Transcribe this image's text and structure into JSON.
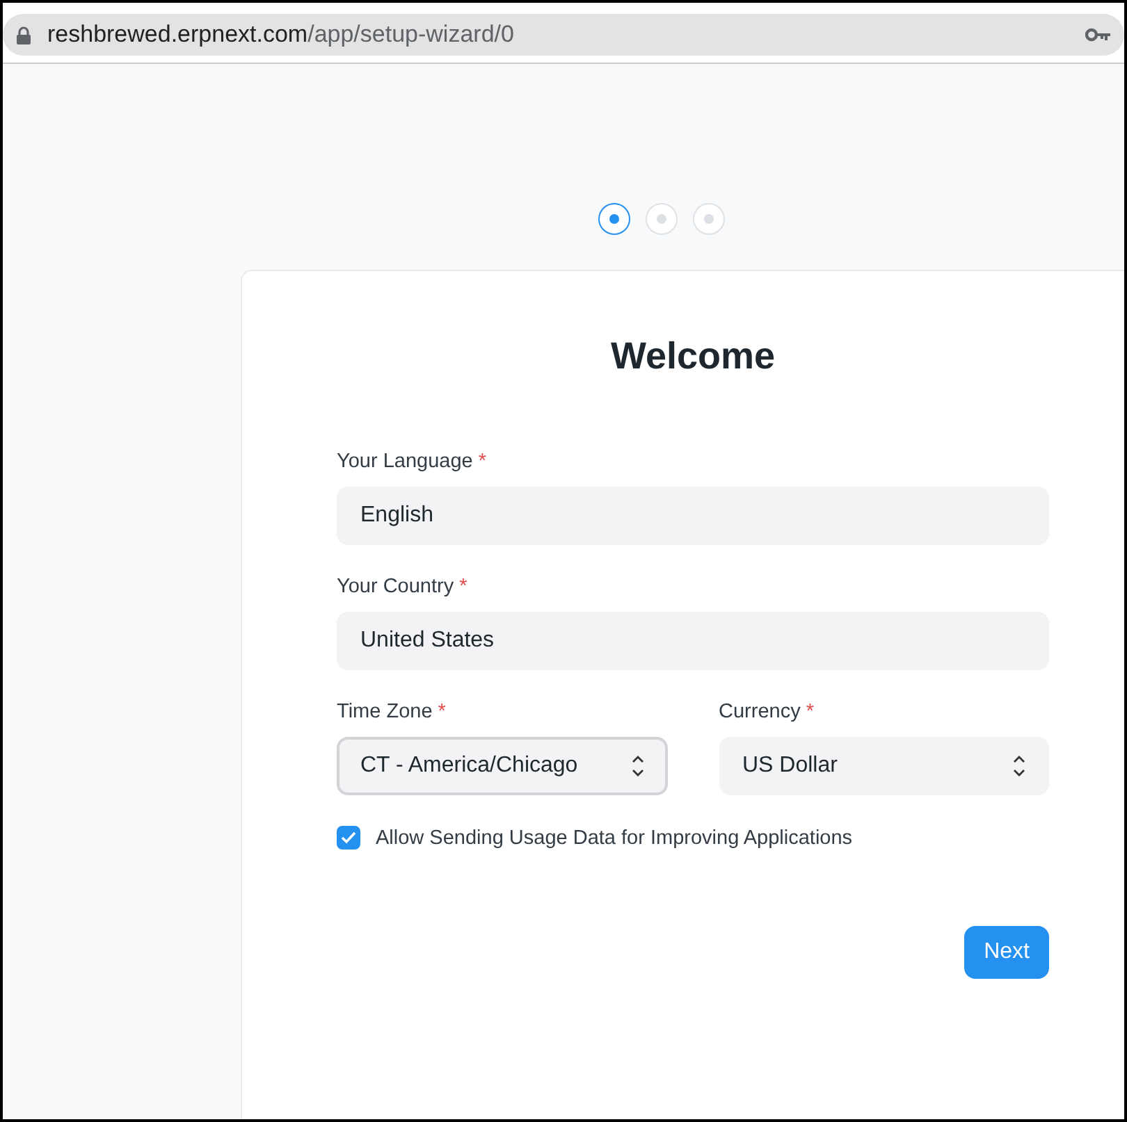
{
  "address_bar": {
    "host": "reshbrewed.erpnext.com",
    "path": "/app/setup-wizard/0"
  },
  "steps": [
    {
      "selected": true
    },
    {
      "selected": false
    },
    {
      "selected": false
    }
  ],
  "card": {
    "title": "Welcome",
    "fields": [
      {
        "kind": "text",
        "label": "Your Language",
        "required_mark": "*",
        "value": "English",
        "focused": false
      },
      {
        "kind": "text",
        "label": "Your Country",
        "required_mark": "*",
        "value": "United States",
        "focused": false
      },
      {
        "kind": "select",
        "label": "Time Zone",
        "required_mark": "*",
        "value": "CT - America/Chicago",
        "focused": true
      },
      {
        "kind": "select",
        "label": "Currency",
        "required_mark": "*",
        "value": "US Dollar",
        "focused": false
      }
    ],
    "checkbox": {
      "label": "Allow Sending Usage Data for Improving Applications",
      "checked": true
    },
    "primary_button": "Next"
  }
}
